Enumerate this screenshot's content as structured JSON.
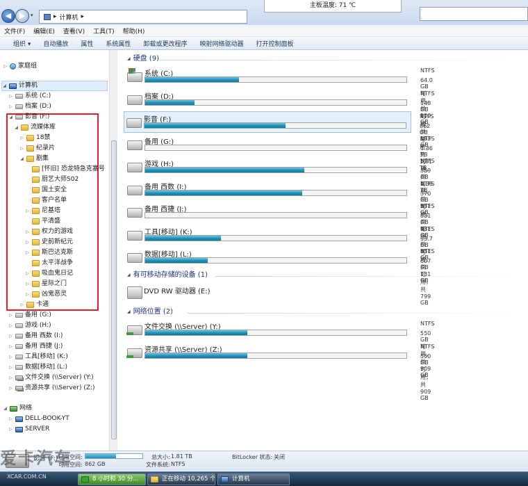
{
  "address": {
    "crumb": "计算机",
    "sep": "▸"
  },
  "temp_tooltip": "主板温度: 71 ℃",
  "menu": [
    "文件(F)",
    "编辑(E)",
    "查看(V)",
    "工具(T)",
    "帮助(H)"
  ],
  "toolbar": [
    "组织 ▾",
    "自动播放",
    "属性",
    "系统属性",
    "卸载或更改程序",
    "映射网络驱动器",
    "打开控制面板"
  ],
  "tree": [
    {
      "label": "家庭组",
      "icon": "home",
      "indent": 0,
      "arrow": "▷"
    },
    {
      "label": "计算机",
      "icon": "computer",
      "indent": 0,
      "arrow": "◢"
    },
    {
      "label": "系统 (C:)",
      "icon": "drive",
      "indent": 1,
      "arrow": "▷"
    },
    {
      "label": "档案 (D:)",
      "icon": "drive",
      "indent": 1,
      "arrow": "▷"
    },
    {
      "label": "影音 (F:)",
      "icon": "drive",
      "indent": 1,
      "arrow": "◢"
    },
    {
      "label": "流媒体库",
      "icon": "folder",
      "indent": 2,
      "arrow": "◢"
    },
    {
      "label": "18禁",
      "icon": "folder",
      "indent": 3,
      "arrow": "▷"
    },
    {
      "label": "纪录片",
      "icon": "folder",
      "indent": 3,
      "arrow": "▷"
    },
    {
      "label": "剧集",
      "icon": "folder",
      "indent": 3,
      "arrow": "◢"
    },
    {
      "label": "[怀旧] 恐龙特急克塞号",
      "icon": "folder",
      "indent": 4,
      "arrow": ""
    },
    {
      "label": "厨艺大师S02",
      "icon": "folder",
      "indent": 4,
      "arrow": ""
    },
    {
      "label": "国土安全",
      "icon": "folder",
      "indent": 4,
      "arrow": ""
    },
    {
      "label": "客户名单",
      "icon": "folder",
      "indent": 4,
      "arrow": ""
    },
    {
      "label": "尼基塔",
      "icon": "folder",
      "indent": 4,
      "arrow": "▷"
    },
    {
      "label": "平清盛",
      "icon": "folder",
      "indent": 4,
      "arrow": ""
    },
    {
      "label": "权力的游戏",
      "icon": "folder",
      "indent": 4,
      "arrow": "▷"
    },
    {
      "label": "史前新纪元",
      "icon": "folder",
      "indent": 4,
      "arrow": "▷"
    },
    {
      "label": "斯巴达克斯",
      "icon": "folder",
      "indent": 4,
      "arrow": "▷"
    },
    {
      "label": "太平洋战争",
      "icon": "folder",
      "indent": 4,
      "arrow": ""
    },
    {
      "label": "吸血鬼日记",
      "icon": "folder",
      "indent": 4,
      "arrow": "▷"
    },
    {
      "label": "星际之门",
      "icon": "folder",
      "indent": 4,
      "arrow": "▷"
    },
    {
      "label": "凶鬼恶灵",
      "icon": "folder",
      "indent": 4,
      "arrow": "▷"
    },
    {
      "label": "卡通",
      "icon": "folder",
      "indent": 3,
      "arrow": "▷"
    },
    {
      "label": "备用 (G:)",
      "icon": "drive",
      "indent": 1,
      "arrow": "▷"
    },
    {
      "label": "游戏 (H:)",
      "icon": "drive",
      "indent": 1,
      "arrow": "▷"
    },
    {
      "label": "备用 西数 (I:)",
      "icon": "drive",
      "indent": 1,
      "arrow": "▷"
    },
    {
      "label": "备用 西捷 (J:)",
      "icon": "drive",
      "indent": 1,
      "arrow": "▷"
    },
    {
      "label": "工具[移动] (K:)",
      "icon": "drive",
      "indent": 1,
      "arrow": "▷"
    },
    {
      "label": "数据[移动] (L:)",
      "icon": "drive",
      "indent": 1,
      "arrow": "▷"
    },
    {
      "label": "文件交换 (\\\\Server) (Y:)",
      "icon": "netdrive",
      "indent": 1,
      "arrow": "▷"
    },
    {
      "label": "资源共享 (\\\\Server) (Z:)",
      "icon": "netdrive",
      "indent": 1,
      "arrow": "▷"
    },
    {
      "label": "网络",
      "icon": "net",
      "indent": 0,
      "arrow": "◢"
    },
    {
      "label": "DELL-BOOK-YT",
      "icon": "computer",
      "indent": 1,
      "arrow": "▷"
    },
    {
      "label": "SERVER",
      "icon": "computer",
      "indent": 1,
      "arrow": "▷"
    }
  ],
  "groups": {
    "hdd": {
      "title": "硬盘 (9)"
    },
    "removable": {
      "title": "有可移动存储的设备 (1)"
    },
    "network": {
      "title": "网络位置 (2)"
    }
  },
  "drives": [
    {
      "name": "系统 (C:)",
      "fs": "NTFS",
      "size": "64.0 GB 可用，共 100 GB",
      "used": 0.36,
      "sys": true
    },
    {
      "name": "档案 (D:)",
      "fs": "NTFS",
      "size": "148 GB 可用，共 183 GB",
      "used": 0.19
    },
    {
      "name": "影音 (F:)",
      "fs": "NTFS",
      "size": "862 GB 可用，共 1.81 TB",
      "used": 0.54,
      "selected": true
    },
    {
      "name": "备用 (G:)",
      "fs": "NTFS",
      "size": "1.36 TB 可用，共 1.36 TB",
      "used": 0.0
    },
    {
      "name": "游戏 (H:)",
      "fs": "NTFS",
      "size": "359 GB 可用，共 931 GB",
      "used": 0.61
    },
    {
      "name": "备用 西数 (I:)",
      "fs": "NTFS",
      "size": "370 GB 可用，共 931 GB",
      "used": 0.6
    },
    {
      "name": "备用 西捷 (J:)",
      "fs": "NTFS",
      "size": "931 GB 可用，共 931 GB",
      "used": 0.0
    },
    {
      "name": "工具[移动] (K:)",
      "fs": "NTFS",
      "size": "93.7 GB 可用，共 131 GB",
      "used": 0.29
    },
    {
      "name": "数据[移动] (L:)",
      "fs": "NTFS",
      "size": "607 GB 可用，共 799 GB",
      "used": 0.24
    }
  ],
  "dvd": {
    "name": "DVD RW 驱动器 (E:)"
  },
  "netdrives": [
    {
      "name": "文件交换 (\\\\Server) (Y:)",
      "fs": "NTFS",
      "size": "550 GB 可用，共 909 GB",
      "used": 0.39
    },
    {
      "name": "资源共享 (\\\\Server) (Z:)",
      "fs": "NTFS",
      "size": "550 GB 可用，共 909 GB",
      "used": 0.39
    }
  ],
  "details": {
    "name": "影音 (F:)",
    "used_label": "已用空间:",
    "free_label": "可用空间:",
    "free": "862 GB",
    "total_label": "总大小:",
    "total": "1.81 TB",
    "fs_label": "文件系统:",
    "fs": "NTFS",
    "bitlocker_label": "BitLocker 状态:",
    "bitlocker": "关闭",
    "used_fraction": 0.54
  },
  "taskbar": {
    "t1": "",
    "t2": "8 小时和 30 分...",
    "t3": "正在移动 10,265 个...",
    "t4": "计算机"
  },
  "watermark": "爱卡汽车",
  "watermark_url": "XCAR.COM.CN"
}
